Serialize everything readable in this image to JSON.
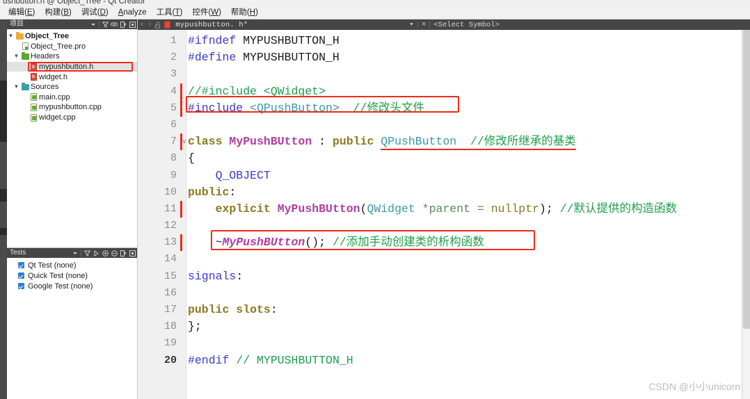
{
  "window": {
    "title": "ushbutton.h @ Object_Tree - Qt Creator"
  },
  "menubar": {
    "items": [
      {
        "label": "编辑",
        "mnemonic": "E"
      },
      {
        "label": "构建",
        "mnemonic": "B"
      },
      {
        "label": "调试",
        "mnemonic": "D"
      },
      {
        "label": "Analyze",
        "mnemonic": ""
      },
      {
        "label": "工具",
        "mnemonic": "T"
      },
      {
        "label": "控件",
        "mnemonic": "W"
      },
      {
        "label": "帮助",
        "mnemonic": "H"
      }
    ]
  },
  "project_panel": {
    "header_title": "项目",
    "tools": [
      "dropdown-icon",
      "filter-icon",
      "link-icon",
      "split-icon",
      "close-panel-icon"
    ],
    "tree": [
      {
        "label": "Object_Tree",
        "icon": "folder-orange-icon",
        "indent": 0,
        "arrow": "expanded",
        "bold": true,
        "selected": false,
        "highlighted": false
      },
      {
        "label": "Object_Tree.pro",
        "icon": "pro-file-icon",
        "indent": 1,
        "arrow": "none",
        "bold": false,
        "selected": false,
        "highlighted": false
      },
      {
        "label": "Headers",
        "icon": "folder-green-icon",
        "indent": 1,
        "arrow": "expanded",
        "bold": false,
        "selected": false,
        "highlighted": false
      },
      {
        "label": "mypushbutton.h",
        "icon": "header-file-icon",
        "indent": 2,
        "arrow": "none",
        "bold": false,
        "selected": true,
        "highlighted": true
      },
      {
        "label": "widget.h",
        "icon": "header-file-icon",
        "indent": 2,
        "arrow": "none",
        "bold": false,
        "selected": false,
        "highlighted": false
      },
      {
        "label": "Sources",
        "icon": "folder-teal-icon",
        "indent": 1,
        "arrow": "expanded",
        "bold": false,
        "selected": false,
        "highlighted": false
      },
      {
        "label": "main.cpp",
        "icon": "cpp-file-icon",
        "indent": 2,
        "arrow": "none",
        "bold": false,
        "selected": false,
        "highlighted": false
      },
      {
        "label": "mypushbutton.cpp",
        "icon": "cpp-file-icon",
        "indent": 2,
        "arrow": "none",
        "bold": false,
        "selected": false,
        "highlighted": false
      },
      {
        "label": "widget.cpp",
        "icon": "cpp-file-icon",
        "indent": 2,
        "arrow": "none",
        "bold": false,
        "selected": false,
        "highlighted": false
      }
    ]
  },
  "tests_panel": {
    "header_title": "Tests",
    "tools": [
      "dropdown-icon",
      "filter-icon",
      "run-icon",
      "expand-all-icon",
      "collapse-all-icon",
      "split-icon",
      "close-panel-icon"
    ],
    "items": [
      {
        "label": "Qt Test (none)",
        "checked": true
      },
      {
        "label": "Quick Test (none)",
        "checked": true
      },
      {
        "label": "Google Test (none)",
        "checked": true
      }
    ]
  },
  "editor_toolbar": {
    "back_label": "‹",
    "forward_label": "›",
    "lock_icon": "unlocked-icon",
    "file_icon": "header-file-icon",
    "filename": "mypushbutton. h*",
    "dropdown_icon": "chevron-down-icon",
    "close_label": "×",
    "symbol_selector": "<Select Symbol>"
  },
  "code": {
    "lines": [
      {
        "n": "1",
        "changed": false,
        "fold": "",
        "current": false
      },
      {
        "n": "2",
        "changed": false,
        "fold": "",
        "current": false
      },
      {
        "n": "3",
        "changed": false,
        "fold": "",
        "current": false
      },
      {
        "n": "4",
        "changed": true,
        "fold": "",
        "current": false
      },
      {
        "n": "5",
        "changed": true,
        "fold": "",
        "current": false
      },
      {
        "n": "6",
        "changed": false,
        "fold": "",
        "current": false
      },
      {
        "n": "7",
        "changed": true,
        "fold": "v",
        "current": false
      },
      {
        "n": "8",
        "changed": false,
        "fold": "",
        "current": false
      },
      {
        "n": "9",
        "changed": false,
        "fold": "",
        "current": false
      },
      {
        "n": "10",
        "changed": false,
        "fold": "",
        "current": false
      },
      {
        "n": "11",
        "changed": true,
        "fold": "",
        "current": false
      },
      {
        "n": "12",
        "changed": false,
        "fold": "",
        "current": false
      },
      {
        "n": "13",
        "changed": true,
        "fold": "",
        "current": false
      },
      {
        "n": "14",
        "changed": false,
        "fold": "",
        "current": false
      },
      {
        "n": "15",
        "changed": false,
        "fold": "",
        "current": false
      },
      {
        "n": "16",
        "changed": false,
        "fold": "",
        "current": false
      },
      {
        "n": "17",
        "changed": false,
        "fold": "",
        "current": false
      },
      {
        "n": "18",
        "changed": false,
        "fold": "",
        "current": false
      },
      {
        "n": "19",
        "changed": false,
        "fold": "",
        "current": false
      },
      {
        "n": "20",
        "changed": false,
        "fold": "",
        "current": true
      }
    ],
    "text": {
      "l1_a": "#ifndef",
      "l1_b": " MYPUSHBUTTON_H",
      "l2_a": "#define",
      "l2_b": " MYPUSHBUTTON_H",
      "l4_a": "//#include <QWidget>",
      "l5_a": "#include",
      "l5_b": " <QPushButton>",
      "l5_c": "  //修改头文件",
      "l7_a": "class ",
      "l7_b": "MyPushBUtton",
      "l7_c": " : ",
      "l7_d": "public ",
      "l7_e": "QPushButton",
      "l7_f": "  //修改所继承的基类",
      "l8_a": "{",
      "l9_a": "    Q_OBJECT",
      "l10_a": "public",
      "l10_b": ":",
      "l11_a": "    explicit ",
      "l11_b": "MyPushBUtton",
      "l11_c": "(",
      "l11_d": "QWidget",
      "l11_e": " *parent = ",
      "l11_f": "nullptr",
      "l11_g": ");",
      "l11_h": " //默认提供的构造函数",
      "l13_a": "    ~",
      "l13_b": "MyPushBUtton",
      "l13_c": "();",
      "l13_d": " //添加手动创建类的析构函数",
      "l15_a": "signals",
      "l15_b": ":",
      "l17_a": "public slots",
      "l17_b": ":",
      "l18_a": "};",
      "l20_a": "#endif",
      "l20_b": " // MYPUSHBUTTON_H"
    }
  },
  "annotations": {
    "box1_label": "include-line-annotation",
    "box2_label": "destructor-line-annotation",
    "underline_label": "base-class-underline",
    "color": "#f02b18"
  },
  "watermark": {
    "text": "CSDN @小小unicorn"
  }
}
